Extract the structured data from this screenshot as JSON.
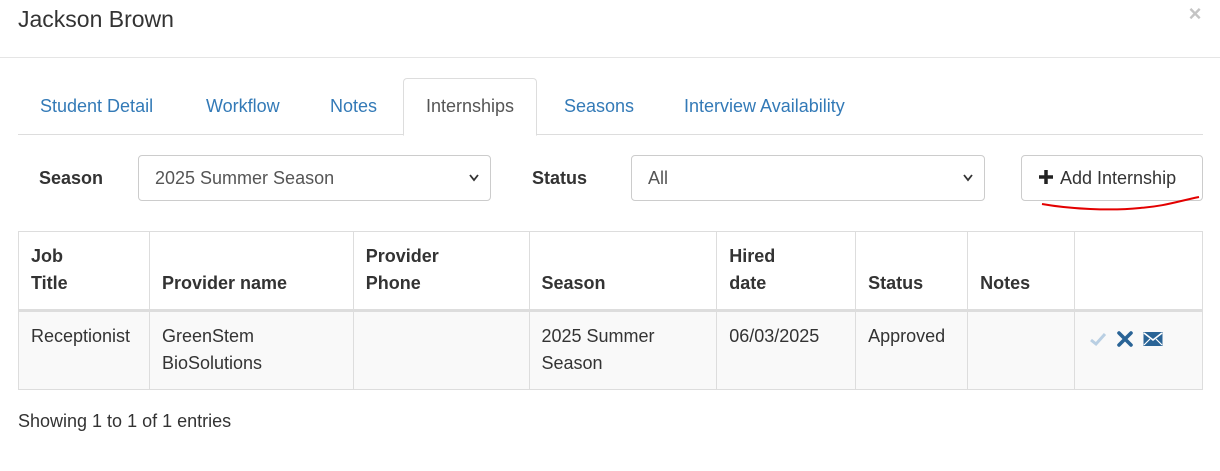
{
  "modal": {
    "title": "Jackson Brown",
    "close_label": "×"
  },
  "tabs": [
    {
      "label": "Student Detail",
      "active": false
    },
    {
      "label": "Workflow",
      "active": false
    },
    {
      "label": "Notes",
      "active": false
    },
    {
      "label": "Internships",
      "active": true
    },
    {
      "label": "Seasons",
      "active": false
    },
    {
      "label": "Interview Availability",
      "active": false
    }
  ],
  "filters": {
    "season_label": "Season",
    "season_value": "2025 Summer Season",
    "status_label": "Status",
    "status_value": "All"
  },
  "toolbar": {
    "add_icon": "plus-icon",
    "add_label": "Add Internship"
  },
  "table": {
    "headers": {
      "job_title": "Job\nTitle",
      "provider_name": "Provider name",
      "provider_phone": "Provider\nPhone",
      "season": "Season",
      "hired_date": "Hired\ndate",
      "status": "Status",
      "notes": "Notes",
      "actions": ""
    },
    "rows": [
      {
        "job_title": "Receptionist",
        "provider_name": "GreenStem\nBioSolutions",
        "provider_phone": "",
        "season": "2025 Summer\nSeason",
        "hired_date": "06/03/2025",
        "status": "Approved",
        "notes": "",
        "actions": [
          "check-icon",
          "delete-x-icon",
          "email-icon"
        ]
      }
    ]
  },
  "footer": {
    "info": "Showing 1 to 1 of 1 entries"
  },
  "colors": {
    "link": "#337ab7",
    "annotation": "#e30000",
    "check_icon": "#b9cfe3",
    "action_icon": "#2a6496"
  }
}
